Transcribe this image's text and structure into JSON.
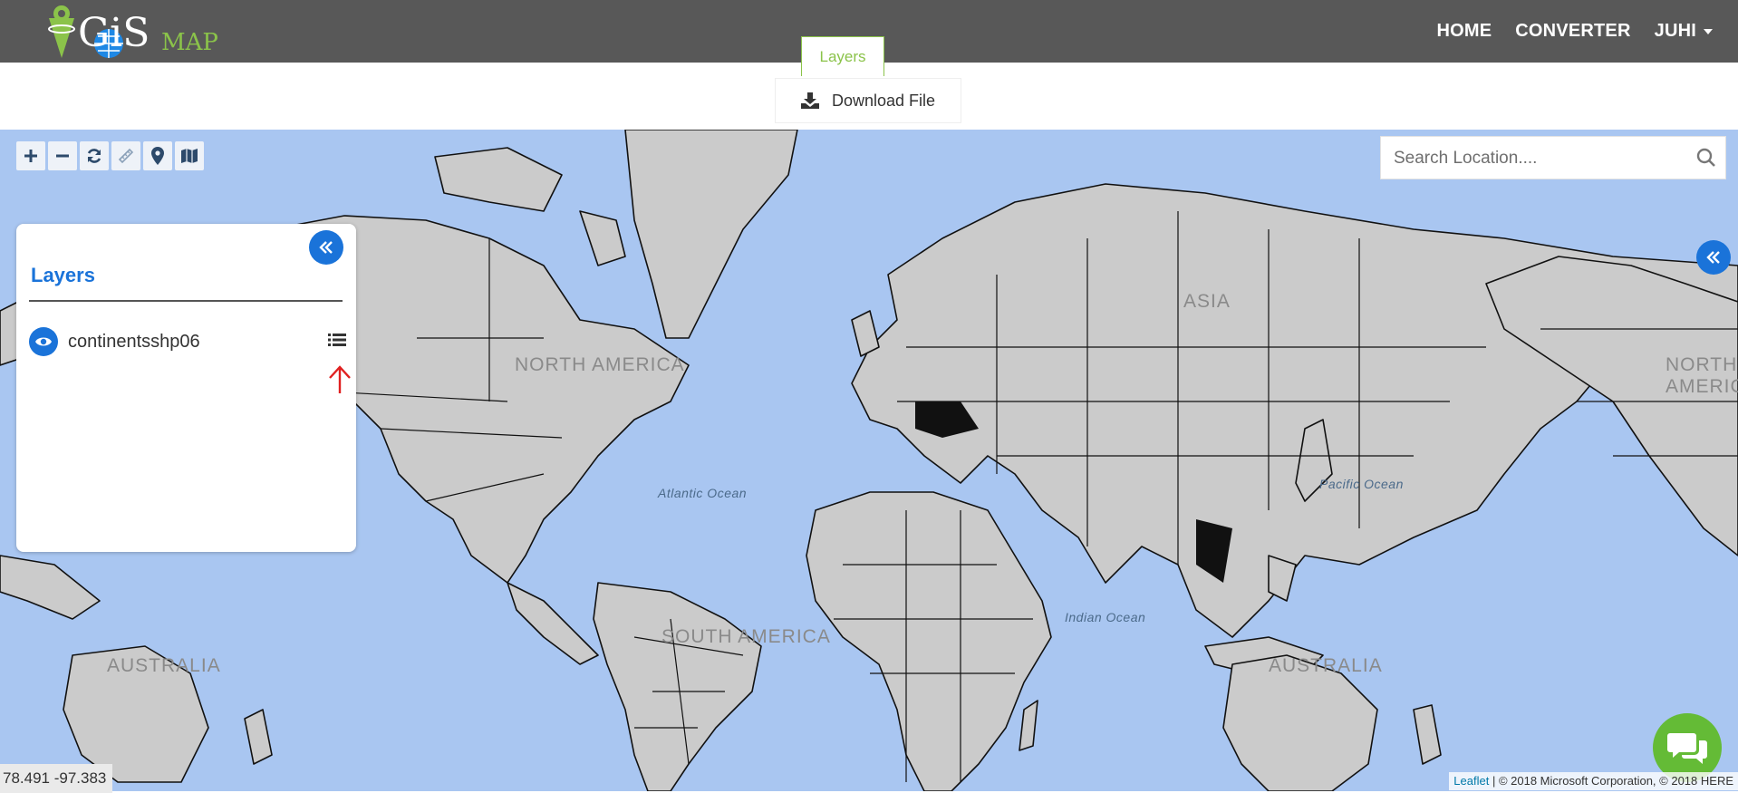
{
  "navbar": {
    "brand_main": "GiS",
    "brand_sub": "MAP",
    "links": [
      "HOME",
      "CONVERTER"
    ],
    "user": "JUHI"
  },
  "tabs": {
    "active": "Layers"
  },
  "download": {
    "label": "Download File"
  },
  "search": {
    "placeholder": "Search Location...."
  },
  "layers_panel": {
    "title": "Layers",
    "items": [
      {
        "name": "continentsshp06"
      }
    ]
  },
  "map": {
    "labels": [
      "NORTH AMERICA",
      "ASIA",
      "NORTH AMERICA",
      "SOUTH AMERICA",
      "AUSTRALIA",
      "AUSTRALIA"
    ],
    "oceans": [
      "Atlantic Ocean",
      "Pacific Ocean",
      "Indian Ocean"
    ]
  },
  "coords": "78.491 -97.383",
  "attribution": {
    "link": "Leaflet",
    "text": " | © 2018 Microsoft Corporation, © 2018 HERE"
  },
  "colors": {
    "navbar": "#585858",
    "accent_green": "#8bc34a",
    "accent_blue": "#1a73d9",
    "ocean": "#a9c6f1",
    "land": "#cbcbcb",
    "chat": "#64bb36"
  }
}
